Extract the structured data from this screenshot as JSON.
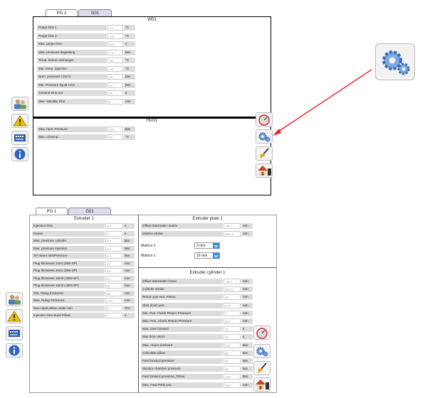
{
  "top": {
    "tabs": [
      {
        "label": "PG 1"
      },
      {
        "label": "G01"
      }
    ],
    "panel1_title": "W01",
    "panel1_rows": [
      {
        "label": "Purge limit 1",
        "value": "-14",
        "unit": "°C"
      },
      {
        "label": "Purge limit 2",
        "value": "-16",
        "unit": "°C"
      },
      {
        "label": "Max. purge time",
        "value": "120",
        "unit": "s"
      },
      {
        "label": "Max. pressure degassing",
        "value": "1.0",
        "unit": "Bar"
      },
      {
        "label": "Temp. before exchanger",
        "value": "-80",
        "unit": "°C"
      },
      {
        "label": "Min. temp. Injection",
        "value": "-40",
        "unit": "°C"
      },
      {
        "label": "Nom. pressure CO2 in",
        "value": "16",
        "unit": "Bar"
      },
      {
        "label": "Min. Pressure liquid CO2",
        "value": "10",
        "unit": "Bar"
      },
      {
        "label": "General time out",
        "value": "30",
        "unit": "s"
      },
      {
        "label": "Max. standby time",
        "value": "5",
        "unit": "min"
      }
    ],
    "panel2_title": "HU01",
    "panel2_rows": [
      {
        "label": "Max. hydr. Pressure",
        "value": "220",
        "unit": "Bar"
      },
      {
        "label": "Max. oil temp.",
        "value": "65",
        "unit": "°C"
      }
    ]
  },
  "bottom": {
    "tabs": [
      {
        "label": "PG 1"
      },
      {
        "label": "G01"
      }
    ],
    "extruder1_title": "Extruder 1",
    "extruder1_rows": [
      {
        "label": "Injection time",
        "value": "9.0",
        "unit": "s"
      },
      {
        "label": "Pause",
        "value": "0",
        "unit": "s"
      },
      {
        "label": "Max. pressure cylinder",
        "value": "0.2",
        "unit": "Bar"
      },
      {
        "label": "Max. pressure injection",
        "value": "4.0",
        "unit": "Bar"
      },
      {
        "label": "SP Alarm InletPressure",
        "value": "5.0",
        "unit": "Bar"
      },
      {
        "label": "Plug thickness 2mm (38S-SP)",
        "value": "40",
        "unit": "mm"
      },
      {
        "label": "Plug thickness 3mm (38S-SP)",
        "value": "40",
        "unit": "mm"
      },
      {
        "label": "Plug thickness 10mm (38S-SP)",
        "value": "40",
        "unit": "mm"
      },
      {
        "label": "Plug thickness 16mm (38S-SP)",
        "value": "40",
        "unit": "mm"
      },
      {
        "label": "Min. Pplug thickness",
        "value": "60",
        "unit": "mm"
      },
      {
        "label": "Max. Pplug thickness",
        "value": "175",
        "unit": "mm"
      },
      {
        "label": "Max rapid pillow under min",
        "value": "5",
        "unit": "Pcs"
      },
      {
        "label": "Injection time Build Pillow",
        "value": "7",
        "unit": "s"
      }
    ],
    "plate1_title": "Extruder plate 1",
    "plate1_rows": [
      {
        "label": "Offset transmitter matrix",
        "value": "-29.7",
        "unit": "mm"
      },
      {
        "label": "Matrice stroke",
        "value": "299.3",
        "unit": "mm"
      }
    ],
    "matrice2_label": "Matrice 2",
    "matrice2_value": "3 mm",
    "matrice1_label": "Matrice 1",
    "matrice1_value": "16 mm",
    "cyl1_title": "Extruder cylinder 1",
    "cyl1_rows": [
      {
        "label": "Offset transmitter home",
        "value": "-39.7",
        "unit": "mm"
      },
      {
        "label": "Cylinder stroke",
        "value": "384.8",
        "unit": "mm"
      },
      {
        "label": "Return pos extr. Piston",
        "value": "30",
        "unit": "mm"
      },
      {
        "label": "Shut down pos",
        "value": "279",
        "unit": "mm"
      },
      {
        "label": "Min. Pos. Check Return Pressure",
        "value": "1",
        "unit": "mm"
      },
      {
        "label": "Max. Pos. Check Return Pressure",
        "value": "254",
        "unit": "mm"
      },
      {
        "label": "Max. time forward",
        "value": "15",
        "unit": "s"
      },
      {
        "label": "Max time return",
        "value": "15",
        "unit": "s"
      },
      {
        "label": "Max. return pressure",
        "value": "100",
        "unit": "Bar"
      },
      {
        "label": "Calculate pillow",
        "value": "80",
        "unit": "Bar"
      },
      {
        "label": "Fast forward pressure",
        "value": "50",
        "unit": "Bar"
      },
      {
        "label": "Monitor chamber pressure",
        "value": "60",
        "unit": "Bar"
      },
      {
        "label": "Fast forward pressure_Pillow",
        "value": "120",
        "unit": "Bar"
      },
      {
        "label": "Max. Fast FWD pos.",
        "value": "152",
        "unit": "mm"
      }
    ]
  },
  "colors": {
    "arrow": "#e8231f",
    "dropdown": "#3c8de0",
    "gear": "#5a8fd0"
  },
  "icons": [
    "users-icon",
    "warning-icon",
    "device-icon",
    "info-icon",
    "gauge-icon",
    "gears-icon",
    "brush-icon",
    "home-icon"
  ]
}
